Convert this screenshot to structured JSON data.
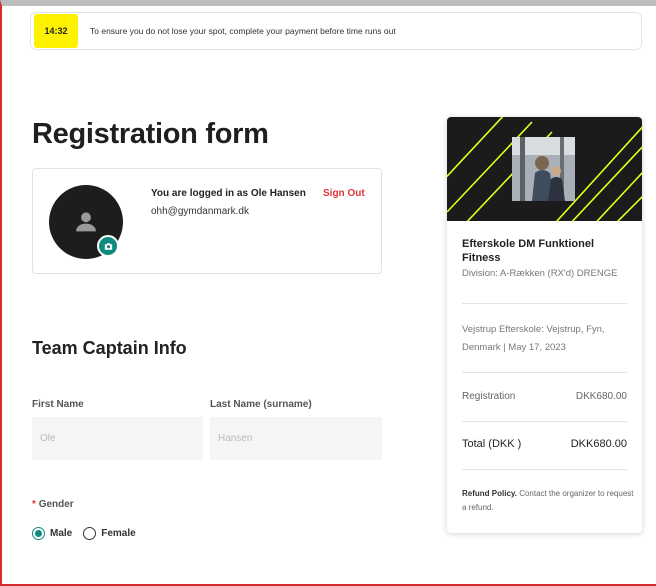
{
  "timer": {
    "time": "14:32",
    "message": "To ensure you do not lose your spot, complete your payment before time runs out"
  },
  "page": {
    "title": "Registration form"
  },
  "user": {
    "logged_in_text": "You are logged in as Ole Hansen",
    "sign_out_label": "Sign Out",
    "email": "ohh@gymdanmark.dk"
  },
  "captain": {
    "section_title": "Team Captain Info",
    "first_name_label": "First Name",
    "first_name_value": "Ole",
    "last_name_label": "Last Name (surname)",
    "last_name_value": "Hansen",
    "gender_required_mark": "*",
    "gender_label": "Gender",
    "gender_options": [
      "Male",
      "Female"
    ],
    "gender_selected": "Male"
  },
  "summary": {
    "event_name": "Efterskole DM Funktionel Fitness",
    "division": "Division: A-Rækken (RX'd) DRENGE",
    "location": "Vejstrup Efterskole: Vejstrup, Fyn, Denmark | May 17, 2023",
    "registration_label": "Registration",
    "registration_value": "DKK680.00",
    "total_label": "Total (DKK )",
    "total_value": "DKK680.00",
    "refund_title": "Refund Policy.",
    "refund_text": "Contact the organizer to request a refund."
  },
  "colors": {
    "timer_badge": "#fff200",
    "accent_teal": "#0f8a7e",
    "sign_out_red": "#e0363a",
    "frame_red": "#d92b2b",
    "banner_lines": "#e8ff1a"
  }
}
